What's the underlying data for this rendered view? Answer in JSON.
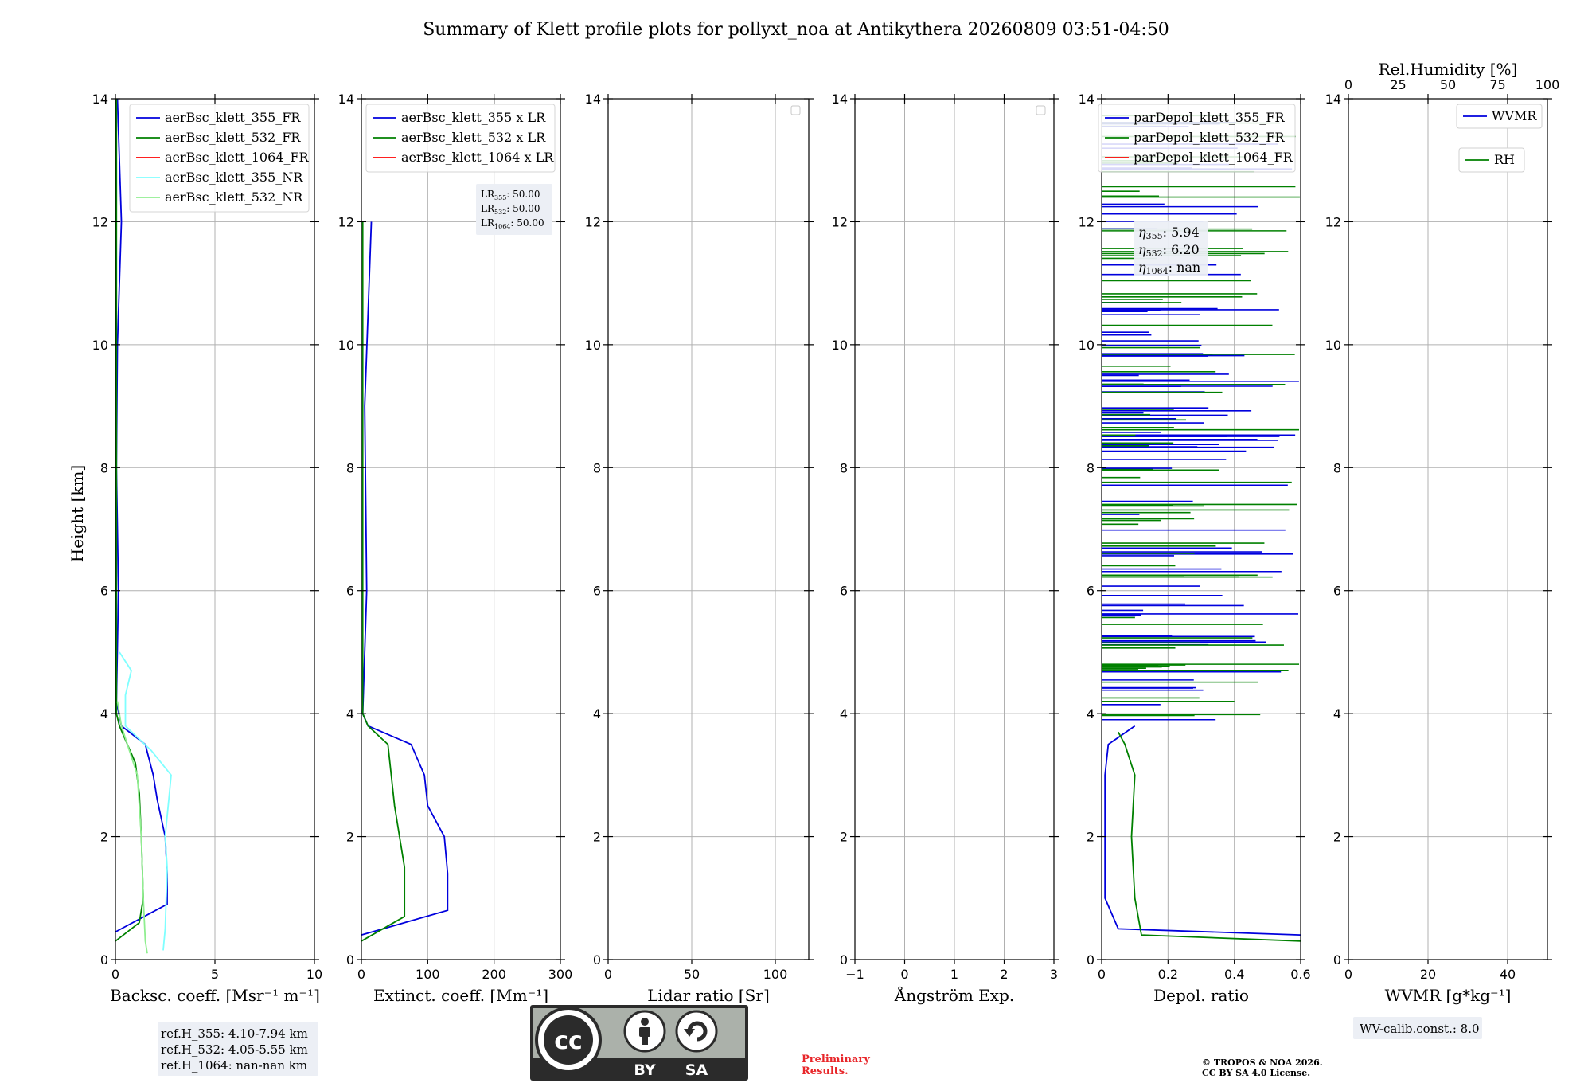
{
  "title": "Summary of Klett profile plots for pollyxt_noa at Antikythera 20260809 03:51-04:50",
  "ylabel": "Height [km]",
  "colors": {
    "b355": "#0000dd",
    "b532": "#008000",
    "b1064": "#ff0000",
    "nr355": "#7fffff",
    "nr532": "#90ee90"
  },
  "ref_heights": [
    "ref.H_355: 4.10-7.94 km",
    "ref.H_532: 4.05-5.55 km",
    "ref.H_1064: nan-nan km"
  ],
  "lidar_ratios": {
    "lr355": "50.00",
    "lr532": "50.00",
    "lr1064": "50.00"
  },
  "angstrom_eta": {
    "eta355": "5.94",
    "eta532": "6.20",
    "eta1064": "nan"
  },
  "wv_calib": "WV-calib.const.: 8.0",
  "license": {
    "cc": "cc",
    "by": "BY",
    "sa": "SA"
  },
  "preliminary": [
    "Preliminary",
    "Results."
  ],
  "copyright": [
    "© TROPOS & NOA 2026.",
    "CC BY SA 4.0 License."
  ],
  "chart_data": [
    {
      "type": "line",
      "xlabel": "Backsc. coeff. [Msr⁻¹ m⁻¹]",
      "ylabel": "Height [km]",
      "xlim": [
        0,
        10
      ],
      "ylim": [
        0,
        14
      ],
      "xticks": [
        0,
        5,
        10
      ],
      "yticks": [
        0,
        2,
        4,
        6,
        8,
        10,
        12,
        14
      ],
      "grid": true,
      "legend": "top-right",
      "series": [
        {
          "name": "aerBsc_klett_355_FR",
          "color": "#0000dd",
          "y": [
            0.45,
            0.9,
            1.4,
            2.0,
            2.6,
            3.0,
            3.5,
            3.8,
            4.2,
            6.0,
            8.0,
            10.0,
            12.0,
            14.0
          ],
          "x": [
            0,
            2.6,
            2.6,
            2.5,
            2.1,
            1.9,
            1.5,
            0.3,
            0.05,
            0.15,
            0.05,
            0.1,
            0.3,
            0.1
          ]
        },
        {
          "name": "aerBsc_klett_532_FR",
          "color": "#008000",
          "y": [
            0.3,
            0.6,
            1.0,
            2.0,
            2.7,
            3.2,
            3.8,
            4.0,
            6.0,
            10.0,
            14.0
          ],
          "x": [
            0,
            1.2,
            1.4,
            1.3,
            1.2,
            1.0,
            0.2,
            0.05,
            0.05,
            0.05,
            0.05
          ]
        },
        {
          "name": "aerBsc_klett_1064_FR",
          "color": "#ff0000",
          "y": [],
          "x": []
        },
        {
          "name": "aerBsc_klett_355_NR",
          "color": "#7fffff",
          "y": [
            0.15,
            0.5,
            1.5,
            2.0,
            3.0,
            3.4,
            3.8,
            4.3,
            4.7,
            5.0
          ],
          "x": [
            2.4,
            2.5,
            2.6,
            2.5,
            2.8,
            1.8,
            0.5,
            0.5,
            0.8,
            0.2
          ]
        },
        {
          "name": "aerBsc_klett_532_NR",
          "color": "#90ee90",
          "y": [
            0.1,
            0.3,
            1.0,
            2.0,
            3.0,
            3.8,
            4.2
          ],
          "x": [
            1.6,
            1.5,
            1.4,
            1.3,
            1.1,
            0.3,
            0.1
          ]
        }
      ]
    },
    {
      "type": "line",
      "xlabel": "Extinct. coeff. [Mm⁻¹]",
      "xlim": [
        0,
        300
      ],
      "ylim": [
        0,
        14
      ],
      "xticks": [
        0,
        100,
        200,
        300
      ],
      "yticks": [
        0,
        2,
        4,
        6,
        8,
        10,
        12,
        14
      ],
      "grid": true,
      "legend": "top-right",
      "series": [
        {
          "name": "aerBsc_klett_355 x LR",
          "color": "#0000dd",
          "y": [
            0.4,
            0.8,
            1.4,
            2.0,
            2.5,
            3.0,
            3.5,
            3.8,
            4.0,
            6.0,
            9.0,
            12.0
          ],
          "x": [
            0,
            130,
            130,
            125,
            100,
            95,
            75,
            10,
            2,
            8,
            5,
            15
          ]
        },
        {
          "name": "aerBsc_klett_532 x LR",
          "color": "#008000",
          "y": [
            0.3,
            0.7,
            1.5,
            2.5,
            3.0,
            3.5,
            3.8,
            4.0,
            8.0,
            12.0
          ],
          "x": [
            0,
            65,
            65,
            50,
            45,
            40,
            10,
            2,
            2,
            2
          ]
        },
        {
          "name": "aerBsc_klett_1064 x LR",
          "color": "#ff0000",
          "y": [],
          "x": []
        }
      ]
    },
    {
      "type": "line",
      "xlabel": "Lidar ratio [Sr]",
      "xlim": [
        0,
        120
      ],
      "ylim": [
        0,
        14
      ],
      "xticks": [
        0,
        50,
        100
      ],
      "yticks": [
        0,
        2,
        4,
        6,
        8,
        10,
        12,
        14
      ],
      "grid": true,
      "series": []
    },
    {
      "type": "line",
      "xlabel": "Ångström Exp.",
      "xlim": [
        -1,
        3
      ],
      "ylim": [
        0,
        14
      ],
      "xticks": [
        -1,
        0,
        1,
        2,
        3
      ],
      "yticks": [
        0,
        2,
        4,
        6,
        8,
        10,
        12,
        14
      ],
      "grid": true,
      "series": []
    },
    {
      "type": "line",
      "xlabel": "Depol. ratio",
      "xlim": [
        0,
        0.6
      ],
      "ylim": [
        0,
        14
      ],
      "xticks": [
        0.0,
        0.2,
        0.4,
        0.6
      ],
      "yticks": [
        0,
        2,
        4,
        6,
        8,
        10,
        12,
        14
      ],
      "grid": true,
      "legend": "top-right",
      "series": [
        {
          "name": "parDepol_klett_355_FR",
          "color": "#0000dd",
          "y": [
            0.4,
            0.5,
            1.0,
            2.0,
            3.0,
            3.5,
            3.8
          ],
          "x": [
            0.6,
            0.05,
            0.01,
            0.01,
            0.01,
            0.02,
            0.1
          ]
        },
        {
          "name": "parDepol_klett_532_FR",
          "color": "#008000",
          "y": [
            0.3,
            0.4,
            1.0,
            2.0,
            3.0,
            3.5,
            3.7
          ],
          "x": [
            0.6,
            0.12,
            0.1,
            0.09,
            0.1,
            0.07,
            0.05
          ]
        },
        {
          "name": "parDepol_klett_1064_FR",
          "color": "#ff0000",
          "y": [],
          "x": []
        }
      ]
    },
    {
      "type": "line",
      "xlabel": "WVMR [g*kg⁻¹]",
      "x2label": "Rel.Humidity [%]",
      "xlim": [
        0,
        50
      ],
      "x2lim": [
        0,
        100
      ],
      "ylim": [
        0,
        14
      ],
      "xticks": [
        0,
        20,
        40
      ],
      "x2ticks": [
        0,
        25,
        50,
        75,
        100
      ],
      "yticks": [
        0,
        2,
        4,
        6,
        8,
        10,
        12,
        14
      ],
      "grid": true,
      "series": [
        {
          "name": "WVMR",
          "color": "#0000dd",
          "y": [],
          "x": []
        },
        {
          "name": "RH",
          "color": "#008000",
          "y": [],
          "x": []
        }
      ]
    }
  ]
}
